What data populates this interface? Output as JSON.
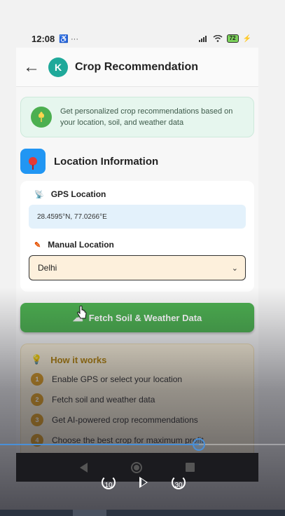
{
  "status_bar": {
    "time": "12:08",
    "left_icons": "♿ ···",
    "battery": "72"
  },
  "app_bar": {
    "back_glyph": "←",
    "avatar_letter": "K",
    "title": "Crop Recommendation"
  },
  "banner": {
    "icon": "wheat-icon",
    "text": "Get personalized crop recommendations based on your location, soil, and weather data"
  },
  "location_section": {
    "title": "Location Information",
    "gps_label": "GPS Location",
    "gps_value": "28.4595°N, 77.0266°E",
    "manual_label": "Manual Location",
    "manual_selected": "Delhi"
  },
  "fetch_button": {
    "label": "Fetch Soil & Weather Data"
  },
  "how_it_works": {
    "title": "How it works",
    "steps": [
      {
        "num": "1",
        "text": "Enable GPS or select your location"
      },
      {
        "num": "2",
        "text": "Fetch soil and weather data"
      },
      {
        "num": "3",
        "text": "Get AI-powered crop recommendations"
      },
      {
        "num": "4",
        "text": "Choose the best crop for maximum profit"
      }
    ]
  },
  "video_player": {
    "progress": 0.698,
    "rewind_label": "10",
    "forward_label": "30"
  },
  "colors": {
    "primary_green": "#4caf50",
    "avatar_teal": "#1fa99a",
    "select_bg": "#fdf0dc",
    "gps_bg": "#e3f1fb",
    "how_bg": "#fff6df",
    "step_badge": "#e0a126",
    "seek_blue": "#4a90d9"
  }
}
